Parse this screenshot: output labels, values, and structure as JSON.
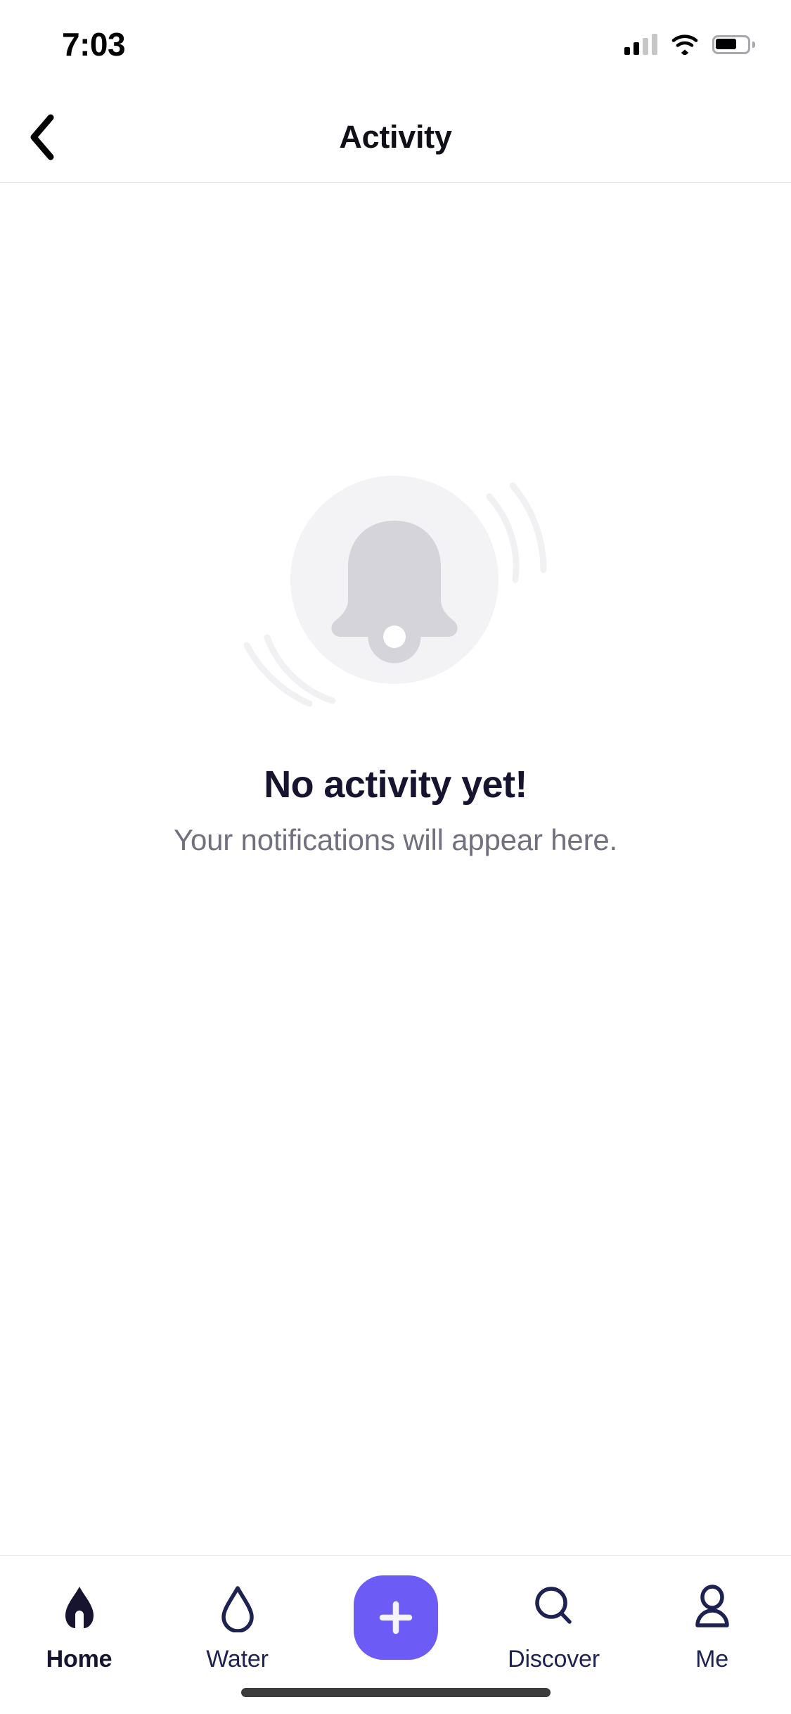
{
  "status_bar": {
    "time": "7:03",
    "signal_icon": "cellular-signal-icon",
    "signal_bars_filled": 2,
    "signal_bars_total": 4,
    "wifi_icon": "wifi-icon",
    "battery_icon": "battery-icon",
    "battery_level_percent": 60
  },
  "header": {
    "back_icon": "chevron-left-icon",
    "title": "Activity"
  },
  "empty_state": {
    "illustration_icon": "bell-ringing-illustration",
    "title": "No activity yet!",
    "subtitle": "Your notifications will appear here."
  },
  "tab_bar": {
    "items": [
      {
        "label": "Home",
        "icon": "home-icon",
        "active": true
      },
      {
        "label": "Water",
        "icon": "water-drop-icon",
        "active": false
      },
      {
        "label": "Discover",
        "icon": "search-icon",
        "active": false
      },
      {
        "label": "Me",
        "icon": "person-icon",
        "active": false
      }
    ],
    "add_button": {
      "icon": "plus-icon",
      "label": ""
    }
  },
  "colors": {
    "accent_purple": "#6C5CF5",
    "title_navy": "#16142E",
    "tab_navy": "#1E2250",
    "muted_gray": "#70707F",
    "illustration_circle": "#F3F3F5",
    "illustration_bell": "#D4D4DA",
    "divider": "#E6E6E9",
    "home_indicator": "#3C3C3C"
  }
}
